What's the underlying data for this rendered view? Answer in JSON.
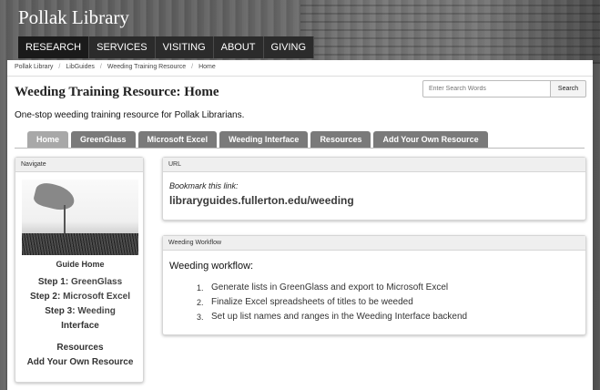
{
  "site": {
    "title": "Pollak Library",
    "nav": [
      "RESEARCH",
      "SERVICES",
      "VISITING",
      "ABOUT",
      "GIVING"
    ]
  },
  "breadcrumb": [
    "Pollak Library",
    "LibGuides",
    "Weeding Training Resource",
    "Home"
  ],
  "page": {
    "title": "Weeding Training Resource: Home",
    "description": "One-stop weeding training resource for Pollak Librarians."
  },
  "search": {
    "placeholder": "Enter Search Words",
    "button": "Search"
  },
  "tabs": [
    "Home",
    "GreenGlass",
    "Microsoft Excel",
    "Weeding Interface",
    "Resources",
    "Add Your Own Resource"
  ],
  "navigate": {
    "heading": "Navigate",
    "guide_home": "Guide Home",
    "step1_prefix": "Step 1:",
    "step1": "GreenGlass",
    "step2_prefix": "Step 2:",
    "step2": "Microsoft Excel",
    "step3_prefix": "Step 3:",
    "step3a": "Weeding",
    "step3b": "Interface",
    "resources": "Resources",
    "add_resource": "Add Your Own Resource"
  },
  "url_box": {
    "heading": "URL",
    "bookmark": "Bookmark this link:",
    "link": "libraryguides.fullerton.edu/weeding"
  },
  "workflow": {
    "heading": "Weeding Workflow",
    "lead": "Weeding workflow:",
    "items": [
      "Generate lists in GreenGlass and export to Microsoft Excel",
      "Finalize Excel spreadsheets of titles to be weeded",
      "Set up list names and ranges in the Weeding Interface backend"
    ]
  }
}
